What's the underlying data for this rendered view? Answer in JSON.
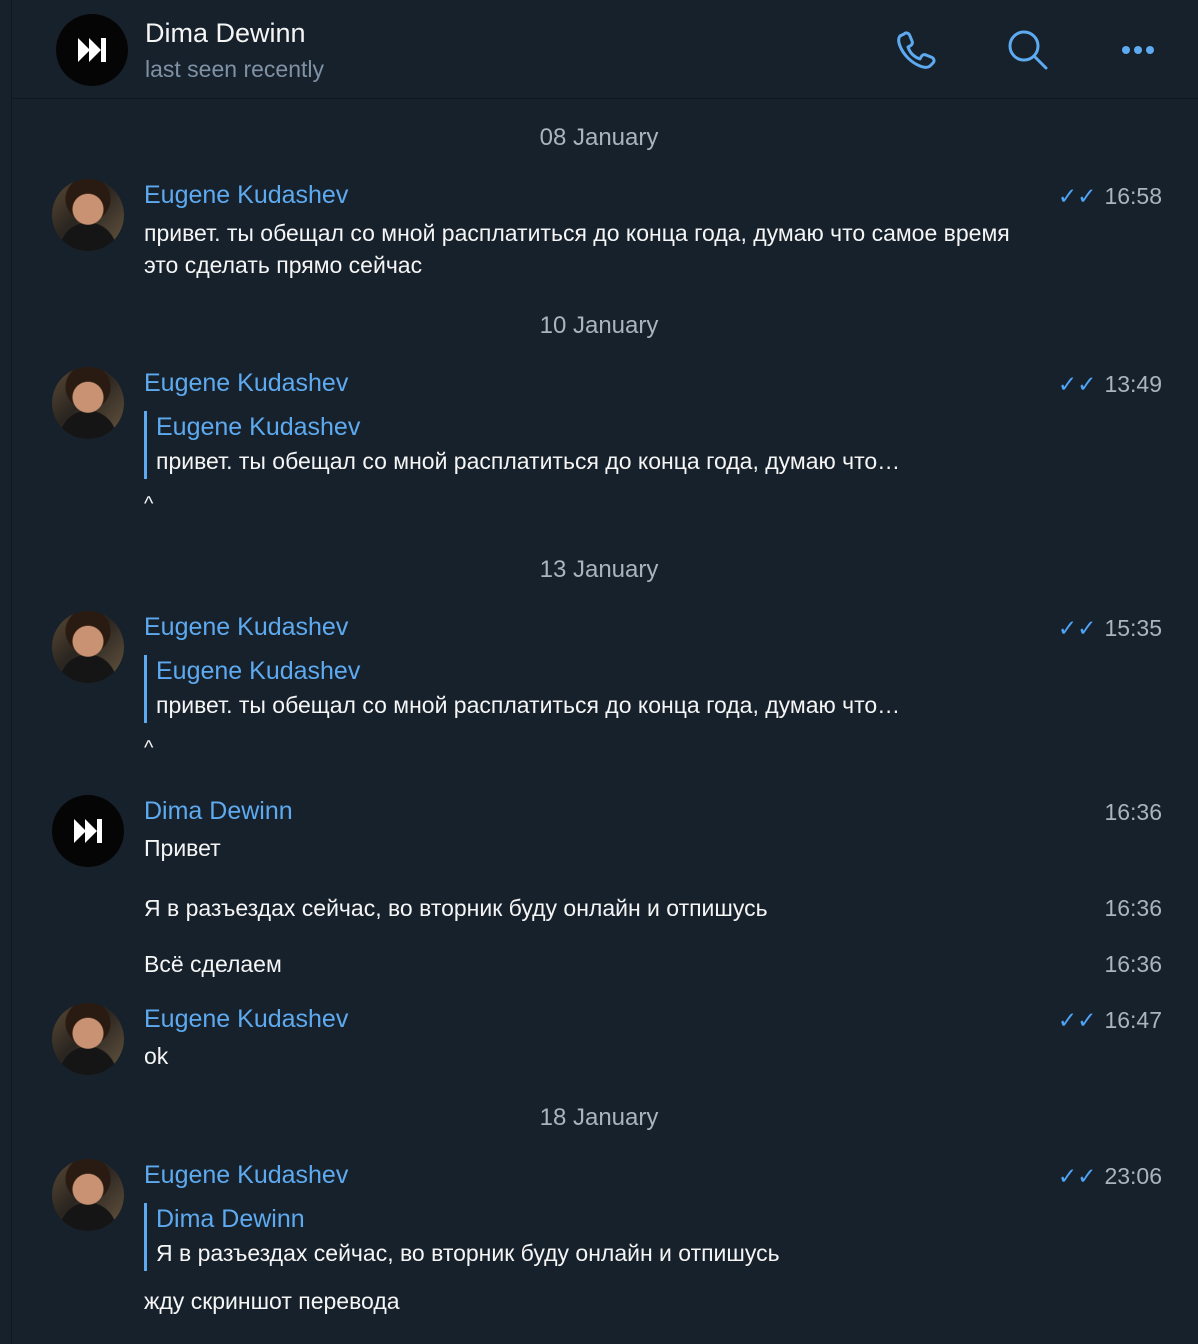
{
  "header": {
    "title": "Dima Dewinn",
    "status": "last seen recently",
    "icons": [
      "phone-icon",
      "search-icon",
      "more-icon"
    ]
  },
  "dates": [
    "08 January",
    "10 January",
    "13 January",
    "18 January"
  ],
  "messages": [
    {
      "sender": "Eugene Kudashev",
      "time": "16:58",
      "text": "привет. ты обещал со мной расплатиться до конца года, думаю что самое время это сделать прямо сейчас"
    },
    {
      "sender": "Eugene Kudashev",
      "time": "13:49",
      "reply_name": "Eugene Kudashev",
      "reply_text": "привет. ты обещал со мной расплатиться до конца года, думаю что…",
      "text": "^"
    },
    {
      "sender": "Eugene Kudashev",
      "time": "15:35",
      "reply_name": "Eugene Kudashev",
      "reply_text": "привет. ты обещал со мной расплатиться до конца года, думаю что…",
      "text": "^"
    },
    {
      "sender": "Dima Dewinn",
      "time": "16:36",
      "text": "Привет"
    },
    {
      "time": "16:36",
      "text": "Я в разъездах сейчас, во вторник буду онлайн и отпишусь"
    },
    {
      "time": "16:36",
      "text": "Всё сделаем"
    },
    {
      "sender": "Eugene Kudashev",
      "time": "16:47",
      "text": "ok"
    },
    {
      "sender": "Eugene Kudashev",
      "time": "23:06",
      "reply_name": "Dima Dewinn",
      "reply_text": "Я в разъездах сейчас, во вторник буду онлайн и отпишусь",
      "text": "жду скриншот перевода"
    }
  ],
  "colors": {
    "background": "#17212b",
    "accent": "#5eaaf0",
    "secondary_text": "#aab4bf"
  }
}
